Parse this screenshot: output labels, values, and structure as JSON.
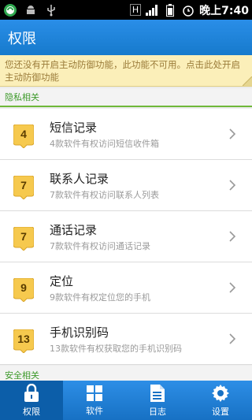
{
  "statusbar": {
    "network_h": "H",
    "time": "晚上7:40"
  },
  "header": {
    "title": "权限"
  },
  "warning": {
    "text": "您还没有开启主动防御功能，此功能不可用。点击此处开启主动防御功能"
  },
  "sections": {
    "privacy": "隐私相关",
    "security": "安全相关"
  },
  "permissions": [
    {
      "count": "4",
      "title": "短信记录",
      "subtitle": "4款软件有权访问短信收件箱"
    },
    {
      "count": "7",
      "title": "联系人记录",
      "subtitle": "7款软件有权访问联系人列表"
    },
    {
      "count": "7",
      "title": "通话记录",
      "subtitle": "7款软件有权访问通话记录"
    },
    {
      "count": "9",
      "title": "定位",
      "subtitle": "9款软件有权定位您的手机"
    },
    {
      "count": "13",
      "title": "手机识别码",
      "subtitle": "13款软件有权获取您的手机识别码"
    }
  ],
  "bottom_nav": [
    {
      "label": "权限",
      "icon": "lock-icon",
      "active": true
    },
    {
      "label": "软件",
      "icon": "grid-icon",
      "active": false
    },
    {
      "label": "日志",
      "icon": "document-icon",
      "active": false
    },
    {
      "label": "设置",
      "icon": "gear-icon",
      "active": false
    }
  ],
  "colors": {
    "accent": "#1e86dd",
    "section_green": "#3d9a2a",
    "badge": "#f6c94e",
    "warning_bg": "#fbefb9"
  }
}
